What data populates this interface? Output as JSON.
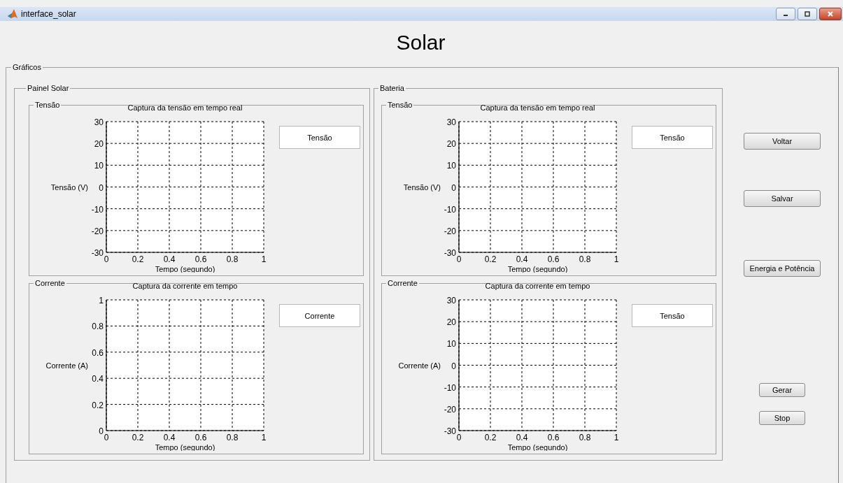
{
  "window": {
    "title": "interface_solar"
  },
  "heading": "Solar",
  "graphs": {
    "title": "Gráficos",
    "panels": [
      {
        "title": "Painel Solar",
        "subpanels": [
          {
            "title": "Tensão",
            "display": "Tensão",
            "chart_data": {
              "type": "line",
              "title": "Captura da tensão em tempo real",
              "xlabel": "Tempo (segundo)",
              "ylabel": "Tensão (V)",
              "xlim": [
                0,
                1
              ],
              "ylim": [
                -30,
                30
              ],
              "xticks": [
                0,
                0.2,
                0.4,
                0.6,
                0.8,
                1
              ],
              "yticks": [
                -30,
                -20,
                -10,
                0,
                10,
                20,
                30
              ],
              "grid": true
            }
          },
          {
            "title": "Corrente",
            "display": "Corrente",
            "chart_data": {
              "type": "line",
              "title": "Captura da corrente em tempo",
              "xlabel": "Tempo (segundo)",
              "ylabel": "Corrente (A)",
              "xlim": [
                0,
                1
              ],
              "ylim": [
                0,
                1
              ],
              "xticks": [
                0,
                0.2,
                0.4,
                0.6,
                0.8,
                1
              ],
              "yticks": [
                0,
                0.2,
                0.4,
                0.6,
                0.8,
                1
              ],
              "grid": true
            }
          }
        ]
      },
      {
        "title": "Bateria",
        "subpanels": [
          {
            "title": "Tensão",
            "display": "Tensão",
            "chart_data": {
              "type": "line",
              "title": "Captura da tensão em tempo real",
              "xlabel": "Tempo (segundo)",
              "ylabel": "Tensão (V)",
              "xlim": [
                0,
                1
              ],
              "ylim": [
                -30,
                30
              ],
              "xticks": [
                0,
                0.2,
                0.4,
                0.6,
                0.8,
                1
              ],
              "yticks": [
                -30,
                -20,
                -10,
                0,
                10,
                20,
                30
              ],
              "grid": true
            }
          },
          {
            "title": "Corrente",
            "display": "Tensão",
            "chart_data": {
              "type": "line",
              "title": "Captura da corrente em tempo",
              "xlabel": "Tempo (segundo)",
              "ylabel": "Corrente (A)",
              "xlim": [
                0,
                1
              ],
              "ylim": [
                -30,
                30
              ],
              "xticks": [
                0,
                0.2,
                0.4,
                0.6,
                0.8,
                1
              ],
              "yticks": [
                -30,
                -20,
                -10,
                0,
                10,
                20,
                30
              ],
              "grid": true
            }
          }
        ]
      }
    ]
  },
  "buttons": [
    {
      "label": "Voltar",
      "kind": "wide"
    },
    {
      "label": "Salvar",
      "kind": "wide"
    },
    {
      "label": "Energia e Potência",
      "kind": "wide"
    },
    {
      "label": "Gerar",
      "kind": "small"
    },
    {
      "label": "Stop",
      "kind": "small"
    }
  ]
}
